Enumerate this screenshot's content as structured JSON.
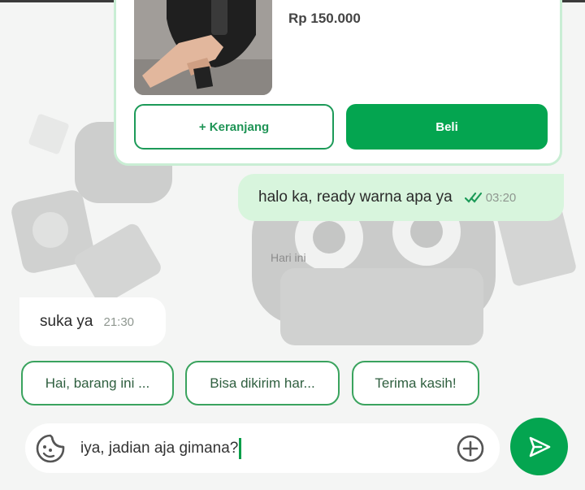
{
  "product": {
    "price": "Rp 150.000",
    "cart_button": "+ Keranjang",
    "buy_button": "Beli"
  },
  "messages": {
    "outgoing": {
      "text": "halo ka, ready warna apa ya",
      "time": "03:20"
    },
    "date_separator": "Hari ini",
    "incoming": {
      "text": "suka ya",
      "time": "21:30"
    }
  },
  "quick_replies": [
    "Hai, barang ini ...",
    "Bisa dikirim har...",
    "Terima kasih!"
  ],
  "composer": {
    "value": "iya, jadian aja gimana?"
  },
  "icons": {
    "sticker": "sticker-icon",
    "add": "plus-icon",
    "send": "send-icon",
    "read": "double-check-icon"
  },
  "colors": {
    "brand": "#04a550",
    "outgoing_bubble": "#d8f5dd",
    "card_border": "#c9eed4"
  }
}
